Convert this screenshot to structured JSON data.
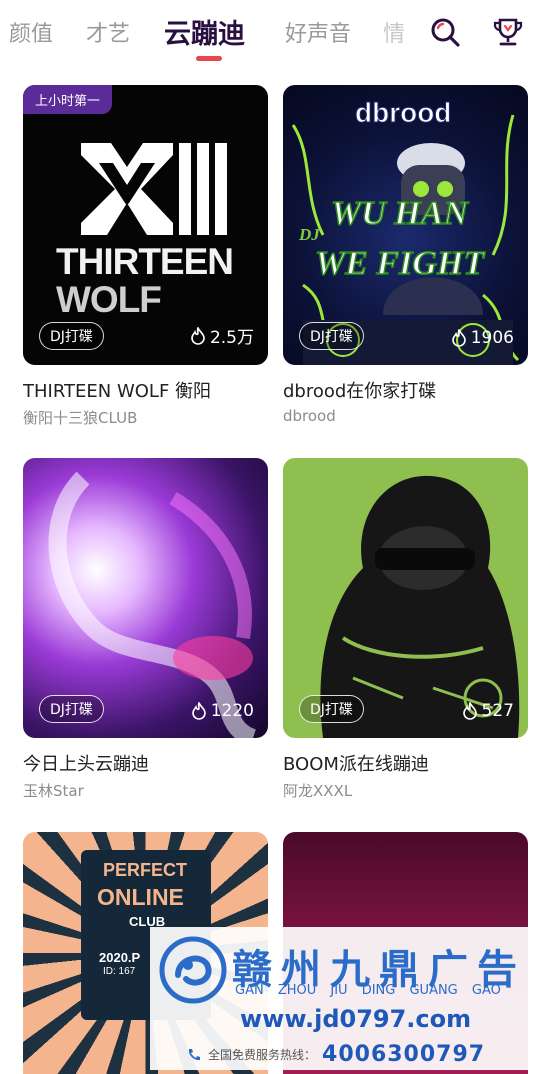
{
  "tabs": [
    {
      "label": "颜值",
      "state": "normal"
    },
    {
      "label": "才艺",
      "state": "normal"
    },
    {
      "label": "云蹦迪",
      "state": "active"
    },
    {
      "label": "好声音",
      "state": "normal"
    },
    {
      "label": "情",
      "state": "faded"
    }
  ],
  "icons": {
    "search": "search-icon",
    "trophy": "trophy-icon"
  },
  "cards": [
    {
      "badge": "上小时第一",
      "tag": "DJ打碟",
      "heat": "2.5万",
      "title": "THIRTEEN WOLF 衡阳",
      "subtitle": "衡阳十三狼CLUB",
      "art_text_1": "THIRTEEN",
      "art_text_2": "WOLF"
    },
    {
      "tag": "DJ打碟",
      "heat": "1906",
      "title": "dbrood在你家打碟",
      "subtitle": "dbrood",
      "art_text_1": "dbrood",
      "art_text_2": "WU HAN",
      "art_text_3": "WE FIGHT",
      "art_text_4": "DJ"
    },
    {
      "tag": "DJ打碟",
      "heat": "1220",
      "title": "今日上头云蹦迪",
      "subtitle": "玉林Star"
    },
    {
      "tag": "DJ打碟",
      "heat": "527",
      "title": "BOOM派在线蹦迪",
      "subtitle": "阿龙XXXL"
    },
    {
      "art_text_1": "PERFECT",
      "art_text_2": "ONLINE",
      "art_text_3": "CLUB",
      "art_text_4": "2020.P",
      "art_text_5": "ID: 167"
    },
    {}
  ],
  "ad": {
    "name": "赣州九鼎广告",
    "pinyin": "GAN ZHOU JIU DING GUANG GAO",
    "url": "www.jd0797.com",
    "hotline_label": "全国免费服务热线：",
    "phone": "4006300797"
  },
  "colors": {
    "accent": "#e5484d",
    "badge": "#5b2b9a",
    "ad_blue": "#2a6cc8"
  }
}
